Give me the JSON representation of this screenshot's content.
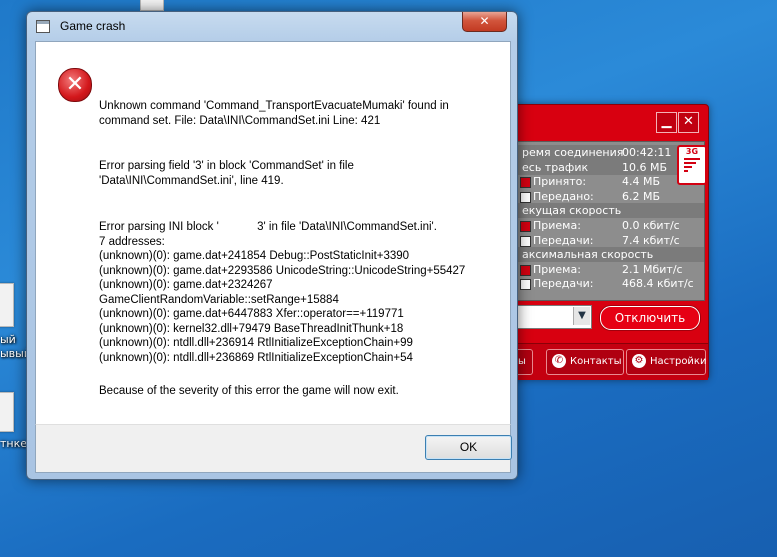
{
  "dialog": {
    "title": "Game crash",
    "close_glyph": "✕",
    "error_icon_glyph": "✕",
    "messages": [
      "Unknown command 'Command_TransportEvacuateMumaki' found in\ncommand set. File: Data\\INI\\CommandSet.ini Line: 421",
      "Error parsing field '3' in block 'CommandSet' in file\n'Data\\INI\\CommandSet.ini', line 419.",
      "Error parsing INI block '            3' in file 'Data\\INI\\CommandSet.ini'.\n7 addresses:\n(unknown)(0): game.dat+241854 Debug::PostStaticInit+3390\n(unknown)(0): game.dat+2293586 UnicodeString::UnicodeString+55427\n(unknown)(0): game.dat+2324267\nGameClientRandomVariable::setRange+15884\n(unknown)(0): game.dat+6447883 Xfer::operator==+119771\n(unknown)(0): kernel32.dll+79479 BaseThreadInitThunk+18\n(unknown)(0): ntdll.dll+236914 RtlInitializeExceptionChain+99\n(unknown)(0): ntdll.dll+236869 RtlInitializeExceptionChain+54",
      "Because of the severity of this error the game will now exit."
    ],
    "ok_label": "OK"
  },
  "modem": {
    "minimize_glyph": "▁",
    "close_glyph": "✕",
    "signal_label": "3G",
    "stats": [
      {
        "label": "ремя соединения",
        "value": "00:42:11",
        "section": true,
        "check": ""
      },
      {
        "label": "есь трафик",
        "value": "10.6 МБ",
        "section": true,
        "check": ""
      },
      {
        "label": "Принято:",
        "value": "4.4 МБ",
        "section": false,
        "check": "red"
      },
      {
        "label": "Передано:",
        "value": "6.2 МБ",
        "section": false,
        "check": "white"
      },
      {
        "label": "екущая скорость",
        "value": "",
        "section": true,
        "check": ""
      },
      {
        "label": "Приема:",
        "value": "0.0 кбит/с",
        "section": false,
        "check": "red"
      },
      {
        "label": "Передачи:",
        "value": "7.4 кбит/с",
        "section": false,
        "check": "white"
      },
      {
        "label": "аксимальная скорость",
        "value": "",
        "section": true,
        "check": ""
      },
      {
        "label": "Приема:",
        "value": "2.1 Мбит/с",
        "section": false,
        "check": "red"
      },
      {
        "label": "Передачи:",
        "value": "468.4 кбит/с",
        "section": false,
        "check": "white"
      }
    ],
    "select_arrow": "▼",
    "disconnect_label": "Отключить",
    "tabs": {
      "partial": "ы",
      "contacts": "Контакты",
      "contacts_icon": "✆",
      "settings": "Настройки",
      "settings_icon": "⚙"
    }
  },
  "desktop": {
    "labels": [
      "ый",
      "ывый.",
      "тнке"
    ]
  }
}
